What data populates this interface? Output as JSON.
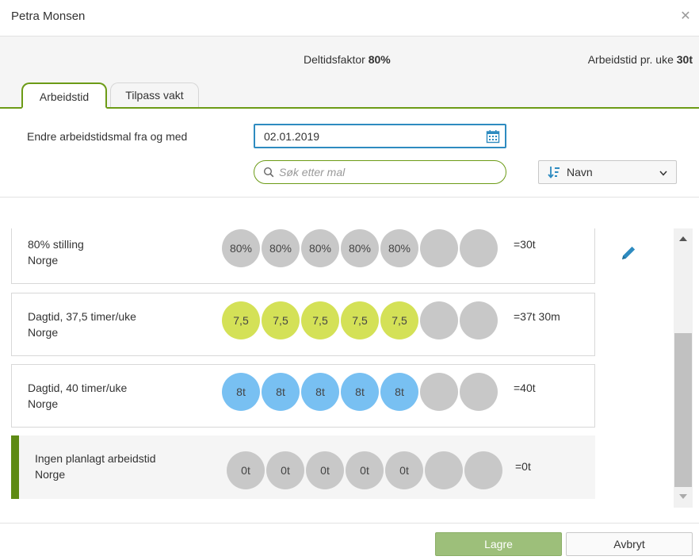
{
  "header": {
    "title": "Petra Monsen",
    "close_icon": "close-icon"
  },
  "info": {
    "deltid_label": "Deltidsfaktor ",
    "deltid_value": "80%",
    "arbeid_label": "Arbeidstid pr. uke ",
    "arbeid_value": "30t"
  },
  "tabs": [
    {
      "label": "Arbeidstid",
      "active": true
    },
    {
      "label": "Tilpass vakt",
      "active": false
    }
  ],
  "form": {
    "date_label": "Endre arbeidstidsmal fra og med",
    "date_value": "02.01.2019",
    "search_placeholder": "Søk etter mal",
    "sort_label": "Navn"
  },
  "colors": {
    "accent_green": "#6c9b16",
    "circle_gray": "#c8c8c8",
    "circle_yellow": "#d4e157",
    "circle_blue": "#78c0f2",
    "focus_blue": "#2e8bc0"
  },
  "templates": [
    {
      "name_line1": "80% stilling",
      "name_line2": "Norge",
      "total": "=30t",
      "color": "#c8c8c8",
      "days": [
        "80%",
        "80%",
        "80%",
        "80%",
        "80%",
        "",
        ""
      ],
      "selected": false
    },
    {
      "name_line1": "Dagtid, 37,5 timer/uke",
      "name_line2": "Norge",
      "total": "=37t 30m",
      "color": "#d4e157",
      "days": [
        "7,5",
        "7,5",
        "7,5",
        "7,5",
        "7,5",
        "",
        ""
      ],
      "selected": false
    },
    {
      "name_line1": "Dagtid, 40 timer/uke",
      "name_line2": "Norge",
      "total": "=40t",
      "color": "#78c0f2",
      "days": [
        "8t",
        "8t",
        "8t",
        "8t",
        "8t",
        "",
        ""
      ],
      "selected": false
    },
    {
      "name_line1": "Ingen planlagt arbeidstid",
      "name_line2": "Norge",
      "total": "=0t",
      "color": "#c8c8c8",
      "days": [
        "0t",
        "0t",
        "0t",
        "0t",
        "0t",
        "",
        ""
      ],
      "selected": true
    }
  ],
  "footer": {
    "save_label": "Lagre",
    "cancel_label": "Avbryt"
  }
}
